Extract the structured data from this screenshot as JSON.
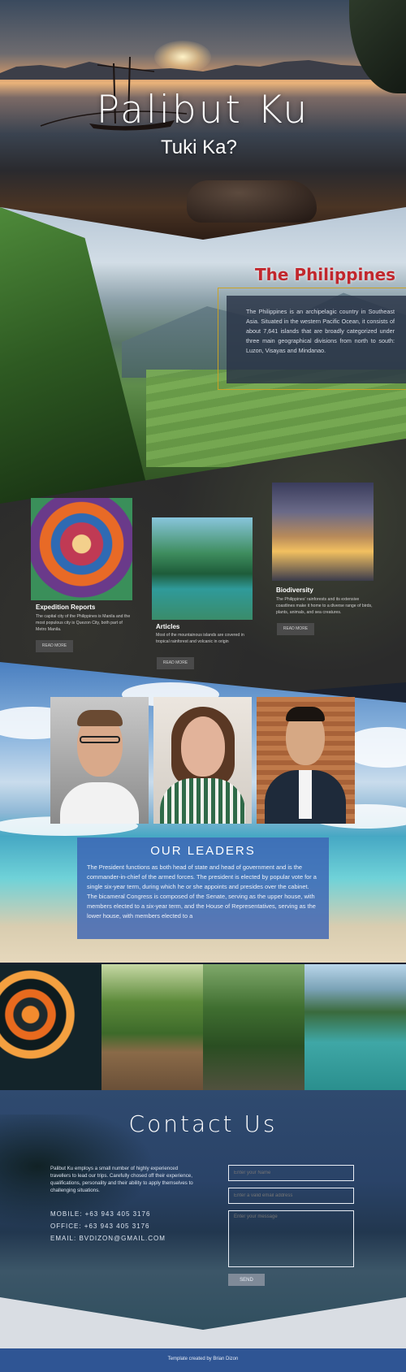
{
  "hero": {
    "title": "Palibut Ku",
    "subtitle": "Tuki Ka?"
  },
  "philippines": {
    "title": "The Philippines",
    "text": "The Philippines is an archipelagic country in Southeast Asia. Situated in the western Pacific Ocean, it consists of about 7,641 islands that are broadly categorized under three main geographical divisions from north to south: Luzon, Visayas and Mindanao."
  },
  "articles": [
    {
      "title": "Expedition Reports",
      "text": "The capital city of the Philippines is Manila and the most populous city is Quezon City, both part of Metro Manila.",
      "button": "READ MORE"
    },
    {
      "title": "Articles",
      "text": "Most of the mountainous islands are covered in tropical rainforest and volcanic in origin",
      "button": "READ MORE"
    },
    {
      "title": "Biodiversity",
      "text": "The Philippines' rainforests and its extensive coastlines make it home to a diverse range of birds, plants, animals, and sea creatures.",
      "button": "READ MORE"
    }
  ],
  "leaders": {
    "title": "OUR LEADERS",
    "text": "The President functions as both head of state and head of government and is the commander-in-chief of the armed forces. The president is elected by popular vote for a single six-year term, during which he or she appoints and presides over the cabinet. The bicameral Congress is composed of the Senate, serving as the upper house, with members elected to a six-year term, and the House of Representatives, serving as the lower house, with members elected to a"
  },
  "contact": {
    "title": "Contact Us",
    "description": "Palibut Ku employs a small number of highly experienced travellers to lead our trips. Carefully chosed off their experience, qualifications, personality and their ability to apply themselves to challenging situations.",
    "mobile": "MOBILE: +63 943 405 3176",
    "office": "OFFICE: +63 943 405 3176",
    "email": "EMAIL: BVDIZON@GMAIL.COM",
    "name_placeholder": "Enter your Name",
    "email_placeholder": "Enter a valid email address",
    "message_placeholder": "Enter your message",
    "send": "SEND"
  },
  "footer": {
    "text": "Template created by Brian Dizon"
  },
  "colors": {
    "philippines_title": "#c1272d",
    "leaders_box": "#3c64b4",
    "footer": "#2f5594"
  }
}
